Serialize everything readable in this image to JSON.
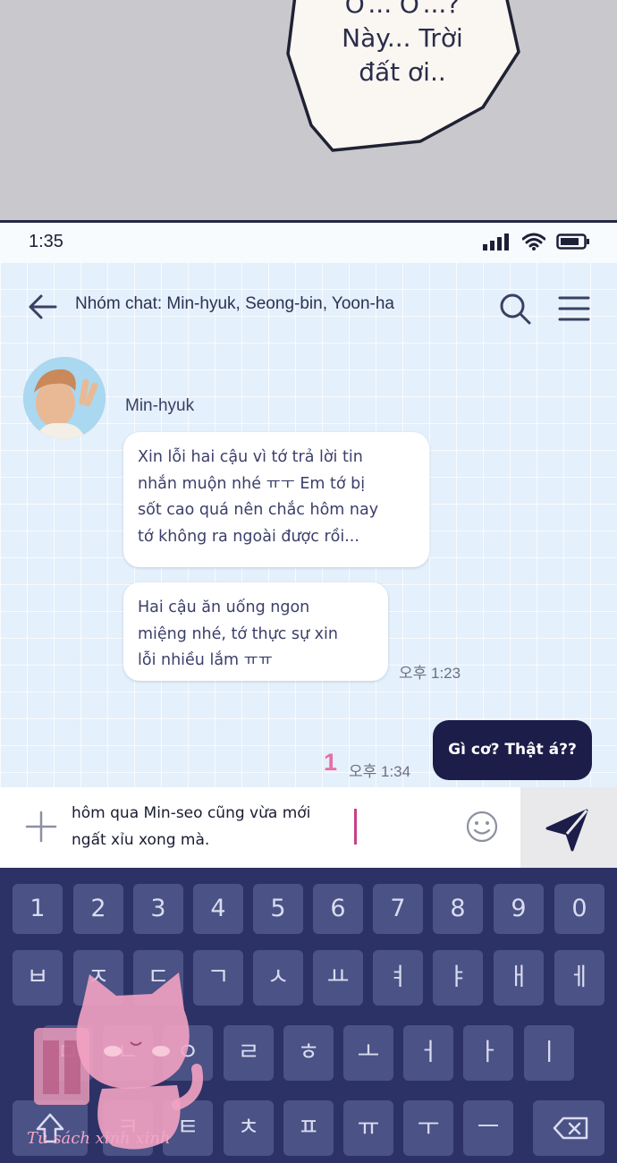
{
  "comic_panel": {
    "speech_lines": [
      "Ơ... Ơ...?",
      "Này... Trời",
      "đất ơi.."
    ]
  },
  "status_bar": {
    "time": "1:35",
    "icons": [
      "signal-icon",
      "wifi-icon",
      "battery-icon"
    ]
  },
  "chat_header": {
    "title": "Nhóm chat: Min-hyuk, Seong-bin, Yoon-ha",
    "icons": [
      "back-arrow-icon",
      "search-icon",
      "menu-icon"
    ]
  },
  "messages": {
    "sender": "Min-hyuk",
    "incoming_1": [
      "Xin lỗi hai cậu vì tớ trả lời tin",
      "nhắn muộn nhé ㅠㅜ Em tớ bị",
      "sốt cao quá nên chắc hôm nay",
      "tớ không ra ngoài được rồi..."
    ],
    "incoming_2": [
      "Hai cậu ăn uống ngon",
      "miệng nhé, tớ thực sự xin",
      "lỗi nhiều lắm ㅠㅠ"
    ],
    "incoming_time": "오후 1:23",
    "outgoing_text": "Gì cơ? Thật á??",
    "outgoing_unread": "1",
    "outgoing_time": "오후 1:34"
  },
  "input_bar": {
    "lines": [
      "hôm qua Min-seo cũng vừa mới",
      "ngất xỉu xong mà."
    ],
    "icons": [
      "plus-icon",
      "smiley-icon",
      "send-icon"
    ]
  },
  "keyboard": {
    "numbers": [
      "1",
      "2",
      "3",
      "4",
      "5",
      "6",
      "7",
      "8",
      "9",
      "0"
    ],
    "row1": [
      "ㅂ",
      "ㅈ",
      "ㄷ",
      "ㄱ",
      "ㅅ",
      "ㅛ",
      "ㅕ",
      "ㅑ",
      "ㅐ",
      "ㅔ"
    ],
    "row2": [
      "ㅁ",
      "ㄴ",
      "ㅇ",
      "ㄹ",
      "ㅎ",
      "ㅗ",
      "ㅓ",
      "ㅏ",
      "ㅣ"
    ],
    "row3": [
      "ㅋ",
      "ㅌ",
      "ㅊ",
      "ㅍ",
      "ㅠ",
      "ㅜ",
      "ㅡ"
    ]
  },
  "watermark": {
    "text": "Tủ sách xinh xinh"
  },
  "colors": {
    "chat_bg": "#e4f0fb",
    "outgoing_bubble": "#1d1d4a",
    "keyboard_bg": "#2d3266",
    "key_bg": "#4a5286",
    "unread_pink": "#e86ea8"
  }
}
